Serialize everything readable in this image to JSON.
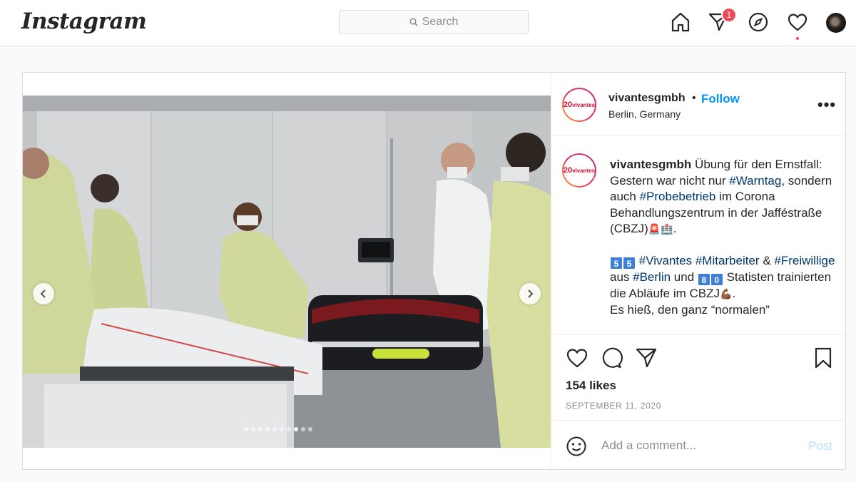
{
  "nav": {
    "logo": "Instagram",
    "search_placeholder": "Search",
    "notification_count": "1",
    "icons": [
      "home-icon",
      "direct-icon",
      "explore-icon",
      "activity-heart-icon",
      "profile-avatar"
    ]
  },
  "post": {
    "username": "vivantesgmbh",
    "follow_label": "Follow",
    "separator": "•",
    "location": "Berlin, Germany",
    "more_label": "•••",
    "avatar_text_num": "20",
    "avatar_text_brand": "vivantes",
    "caption": {
      "username": "vivantesgmbh",
      "p1_a": " Übung für den Ernstfall: Gestern war nicht nur ",
      "tag_warntag": "#Warntag",
      "p1_b": ", sondern auch ",
      "tag_probebetrieb": "#Probebetrieb",
      "p1_c": " im Corona Behandlungszentrum in der Jafféstraße (CBZJ)",
      "p1_emoji": "🚨🏥",
      "p1_end": ".",
      "p2_num1": "5",
      "p2_num2": "5",
      "tag_vivantes": "#Vivantes",
      "tag_mitarbeiter": "#Mitarbeiter",
      "p2_amp": " & ",
      "tag_freiwillige": "#Freiwillige",
      "p2_aus": " aus ",
      "tag_berlin": "#Berlin",
      "p2_und": " und ",
      "p2_num3": "8",
      "p2_num4": "0",
      "p2_rest": " Statisten trainierten die Abläufe im CBZJ",
      "p2_emoji": "💪🏾",
      "p2_end": ".",
      "p3": "Es hieß, den ganz “normalen”"
    },
    "likes": "154 likes",
    "date": "SEPTEMBER 11, 2020",
    "comment_placeholder": "Add a comment...",
    "post_button": "Post",
    "carousel": {
      "count": 10,
      "active_index": 7
    }
  },
  "colors": {
    "link_blue": "#0095f6",
    "hashtag": "#00376b",
    "badge_red": "#ed4956",
    "border": "#dbdbdb"
  }
}
